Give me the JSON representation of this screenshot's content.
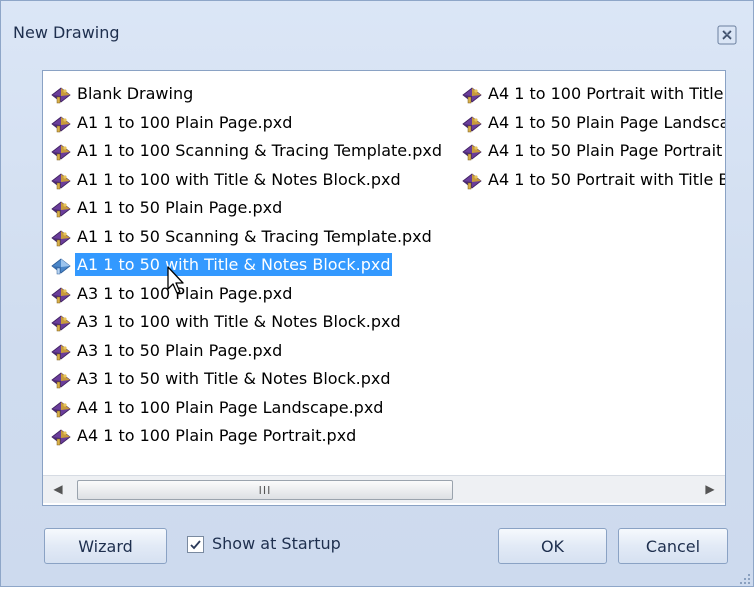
{
  "window": {
    "title": "New Drawing"
  },
  "list": {
    "column1": [
      {
        "label": "Blank Drawing",
        "icon": "template-file-icon"
      },
      {
        "label": "A1 1 to 100 Plain Page.pxd",
        "icon": "template-file-icon"
      },
      {
        "label": "A1 1 to 100 Scanning & Tracing Template.pxd",
        "icon": "template-file-icon"
      },
      {
        "label": "A1 1 to 100 with Title & Notes Block.pxd",
        "icon": "template-file-icon"
      },
      {
        "label": "A1 1 to 50 Plain Page.pxd",
        "icon": "template-file-icon"
      },
      {
        "label": "A1 1 to 50 Scanning & Tracing Template.pxd",
        "icon": "template-file-icon"
      },
      {
        "label": "A1 1 to 50 with Title & Notes Block.pxd",
        "icon": "template-file-icon",
        "selected": true
      },
      {
        "label": "A3 1 to 100 Plain Page.pxd",
        "icon": "template-file-icon"
      },
      {
        "label": "A3 1 to 100 with Title & Notes Block.pxd",
        "icon": "template-file-icon"
      },
      {
        "label": "A3 1 to 50 Plain Page.pxd",
        "icon": "template-file-icon"
      },
      {
        "label": "A3 1 to 50 with Title & Notes Block.pxd",
        "icon": "template-file-icon"
      },
      {
        "label": "A4 1 to 100 Plain Page Landscape.pxd",
        "icon": "template-file-icon"
      },
      {
        "label": "A4 1 to 100 Plain Page Portrait.pxd",
        "icon": "template-file-icon"
      }
    ],
    "column2": [
      {
        "label": "A4 1 to 100 Portrait with Title",
        "icon": "template-file-icon"
      },
      {
        "label": "A4 1 to 50 Plain Page Landsca",
        "icon": "template-file-icon"
      },
      {
        "label": "A4 1 to 50 Plain Page Portrait",
        "icon": "template-file-icon"
      },
      {
        "label": "A4 1 to 50 Portrait with Title B",
        "icon": "template-file-icon"
      }
    ],
    "scroll_thumb_glyph": "III"
  },
  "footer": {
    "wizard_label": "Wizard",
    "show_startup_label": "Show at Startup",
    "show_startup_checked": true,
    "ok_label": "OK",
    "cancel_label": "Cancel"
  },
  "colors": {
    "selection": "#3399ff",
    "dialog_bg": "#cfdcef",
    "border": "#8aa2c4"
  }
}
